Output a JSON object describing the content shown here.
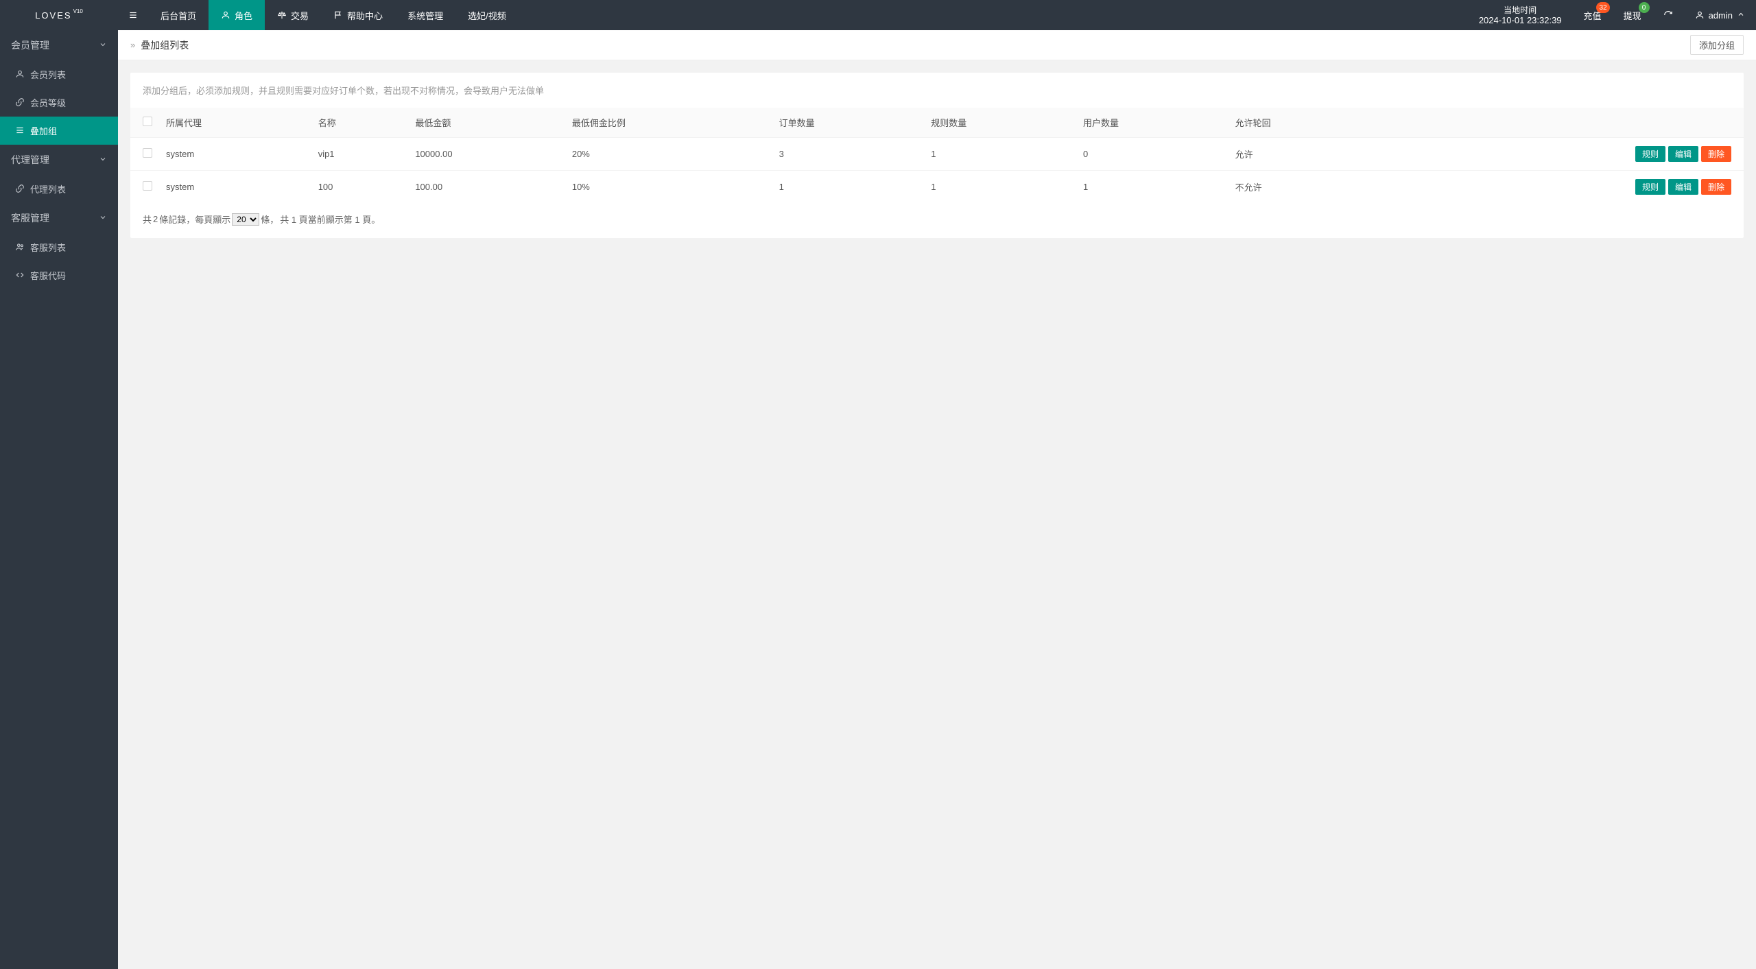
{
  "brand": {
    "name": "LOVES",
    "version": "V10"
  },
  "topnav": [
    {
      "label": "后台首页",
      "icon": "home"
    },
    {
      "label": "角色",
      "icon": "user",
      "active": true
    },
    {
      "label": "交易",
      "icon": "scale"
    },
    {
      "label": "帮助中心",
      "icon": "flag"
    },
    {
      "label": "系统管理",
      "icon": ""
    },
    {
      "label": "选妃/视频",
      "icon": ""
    }
  ],
  "clock": {
    "label": "当地时间",
    "value": "2024-10-01 23:32:39"
  },
  "right_actions": {
    "recharge": {
      "label": "充值",
      "badge": "32"
    },
    "withdraw": {
      "label": "提现",
      "badge": "0"
    }
  },
  "current_user": {
    "name": "admin"
  },
  "sidebar": {
    "groups": [
      {
        "title": "会员管理",
        "items": [
          {
            "label": "会员列表",
            "icon": "user"
          },
          {
            "label": "会员等级",
            "icon": "link"
          },
          {
            "label": "叠加组",
            "icon": "list",
            "active": true
          }
        ]
      },
      {
        "title": "代理管理",
        "items": [
          {
            "label": "代理列表",
            "icon": "link"
          }
        ]
      },
      {
        "title": "客服管理",
        "items": [
          {
            "label": "客服列表",
            "icon": "users"
          },
          {
            "label": "客服代码",
            "icon": "code"
          }
        ]
      }
    ]
  },
  "page": {
    "breadcrumb_title": "叠加组列表",
    "add_btn": "添加分组",
    "hint": "添加分组后，必须添加规则，并且规则需要对应好订单个数，若出现不对称情况，会导致用户无法做单"
  },
  "table": {
    "columns": [
      "所属代理",
      "名称",
      "最低金额",
      "最低佣金比例",
      "订单数量",
      "规则数量",
      "用户数量",
      "允许轮回"
    ],
    "rows": [
      {
        "agent": "system",
        "name": "vip1",
        "min_amount": "10000.00",
        "min_rate": "20%",
        "orders": "3",
        "rules": "1",
        "users": "0",
        "reloop": "允许"
      },
      {
        "agent": "system",
        "name": "100",
        "min_amount": "100.00",
        "min_rate": "10%",
        "orders": "1",
        "rules": "1",
        "users": "1",
        "reloop": "不允许"
      }
    ],
    "actions": {
      "rule": "规则",
      "edit": "编辑",
      "delete": "删除"
    }
  },
  "pager": {
    "pre": "共 ",
    "total": "2",
    "post1": " 條記錄，每頁顯示 ",
    "page_size_options": [
      "20"
    ],
    "selected_page_size": "20",
    "post2": " 條，",
    "post3": "共 1 頁當前顯示第 1 頁。"
  }
}
